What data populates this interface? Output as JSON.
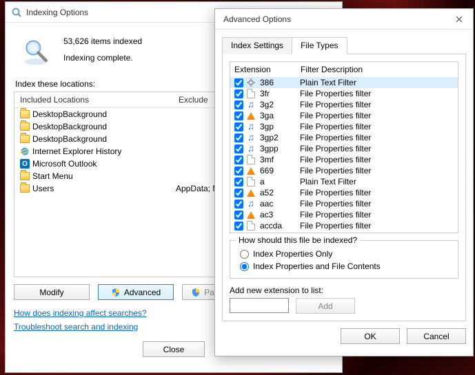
{
  "indexing": {
    "title": "Indexing Options",
    "items_indexed": "53,626 items indexed",
    "status": "Indexing complete.",
    "locations_label": "Index these locations:",
    "col_included": "Included Locations",
    "col_exclude": "Exclude",
    "locations": [
      {
        "name": "DesktopBackground",
        "icon": "folder",
        "exclude": ""
      },
      {
        "name": "DesktopBackground",
        "icon": "folder",
        "exclude": ""
      },
      {
        "name": "DesktopBackground",
        "icon": "folder",
        "exclude": ""
      },
      {
        "name": "Internet Explorer History",
        "icon": "ie",
        "exclude": ""
      },
      {
        "name": "Microsoft Outlook",
        "icon": "outlook",
        "exclude": ""
      },
      {
        "name": "Start Menu",
        "icon": "folder",
        "exclude": ""
      },
      {
        "name": "Users",
        "icon": "folder",
        "exclude": "AppData; M"
      }
    ],
    "btn_modify": "Modify",
    "btn_advanced": "Advanced",
    "btn_pause": "Pa",
    "link_how": "How does indexing affect searches?",
    "link_trouble": "Troubleshoot search and indexing",
    "btn_close": "Close"
  },
  "advanced": {
    "title": "Advanced Options",
    "tab_index": "Index Settings",
    "tab_filetypes": "File Types",
    "col_ext": "Extension",
    "col_filter": "Filter Description",
    "filetypes": [
      {
        "ext": "386",
        "desc": "Plain Text Filter",
        "icon": "gear",
        "checked": true,
        "selected": true
      },
      {
        "ext": "3fr",
        "desc": "File Properties filter",
        "icon": "file",
        "checked": true
      },
      {
        "ext": "3g2",
        "desc": "File Properties filter",
        "icon": "music",
        "checked": true
      },
      {
        "ext": "3ga",
        "desc": "File Properties filter",
        "icon": "vlc",
        "checked": true
      },
      {
        "ext": "3gp",
        "desc": "File Properties filter",
        "icon": "music",
        "checked": true
      },
      {
        "ext": "3gp2",
        "desc": "File Properties filter",
        "icon": "music",
        "checked": true
      },
      {
        "ext": "3gpp",
        "desc": "File Properties filter",
        "icon": "music",
        "checked": true
      },
      {
        "ext": "3mf",
        "desc": "File Properties filter",
        "icon": "file",
        "checked": true
      },
      {
        "ext": "669",
        "desc": "File Properties filter",
        "icon": "vlc",
        "checked": true
      },
      {
        "ext": "a",
        "desc": "Plain Text Filter",
        "icon": "file",
        "checked": true
      },
      {
        "ext": "a52",
        "desc": "File Properties filter",
        "icon": "vlc",
        "checked": true
      },
      {
        "ext": "aac",
        "desc": "File Properties filter",
        "icon": "music",
        "checked": true
      },
      {
        "ext": "ac3",
        "desc": "File Properties filter",
        "icon": "vlc",
        "checked": true
      },
      {
        "ext": "accda",
        "desc": "File Properties filter",
        "icon": "file",
        "checked": true
      }
    ],
    "group_title": "How should this file be indexed?",
    "radio_props": "Index Properties Only",
    "radio_contents": "Index Properties and File Contents",
    "add_label": "Add new extension to list:",
    "btn_add": "Add",
    "btn_ok": "OK",
    "btn_cancel": "Cancel"
  }
}
